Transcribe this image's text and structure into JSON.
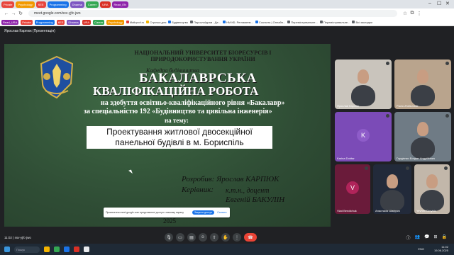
{
  "browser": {
    "tabs": [
      {
        "label": "Private",
        "color": "#e8453c"
      },
      {
        "label": "Psychology",
        "color": "#f29900"
      },
      {
        "label": "КЕЕ",
        "color": "#e8453c"
      },
      {
        "label": "Programming",
        "color": "#1a73e8"
      },
      {
        "label": "Dharma",
        "color": "#7e57c2"
      },
      {
        "label": "Career",
        "color": "#34a853"
      },
      {
        "label": "URA",
        "color": "#d93025"
      },
      {
        "label": "Read_EN",
        "color": "#8e24aa"
      }
    ],
    "url": "meet.google.com/ssv-yjfc-jwo",
    "bookmarks": [
      {
        "label": "Read_URA",
        "color": "#8e24aa",
        "kind": "colored"
      },
      {
        "label": "Private",
        "color": "#e8453c",
        "kind": "colored"
      },
      {
        "label": "Programming",
        "color": "#1a73e8",
        "kind": "colored"
      },
      {
        "label": "КЕЕ",
        "color": "#e8453c",
        "kind": "colored"
      },
      {
        "label": "Dharma",
        "color": "#7e57c2",
        "kind": "colored"
      },
      {
        "label": "URA",
        "color": "#d93025",
        "kind": "colored"
      },
      {
        "label": "Career",
        "color": "#34a853",
        "kind": "colored"
      },
      {
        "label": "Psychology",
        "color": "#f29900",
        "kind": "colored"
      },
      {
        "label": "Mathprof.ru",
        "color": "#e53935",
        "kind": "plain"
      },
      {
        "label": "Строчка для",
        "color": "#f4b400",
        "kind": "plain"
      },
      {
        "label": "Будівництво",
        "color": "#1a73e8",
        "kind": "plain"
      },
      {
        "label": "Пароклоїдизм - Де...",
        "color": "#5f6368",
        "kind": "plain"
      },
      {
        "label": "НМ КБ: Регламенв...",
        "color": "#1a73e8",
        "kind": "plain"
      },
      {
        "label": "Coursera | Онлайн...",
        "color": "#1a73e8",
        "kind": "plain"
      },
      {
        "label": "Перемістуєвальне...",
        "color": "#5f6368",
        "kind": "plain"
      },
      {
        "label": "Перемістуєвальне...",
        "color": "#5f6368",
        "kind": "plain"
      },
      {
        "label": "Всі закладки",
        "color": "#5f6368",
        "kind": "plain"
      }
    ]
  },
  "meet": {
    "presenter_label": "Ярослав Карпюк (Презентація)",
    "meeting_code": "ssv-yjfc-jwo",
    "time": "11:02",
    "notice": {
      "message": "Присвоєння meet.google.com представлені доступ з вашому екрану",
      "primary": "Закрити доступ",
      "secondary": "Сховати"
    }
  },
  "slide": {
    "university": "НАЦІОНАЛЬНИЙ УНІВЕРСИТЕТ БІОРЕСУРСІВ І ПРИРОДОКОРИСТУВАННЯ УКРАЇНИ",
    "department": "Кафедра будівництва",
    "title_line1": "БАКАЛАВРСЬКА",
    "title_line2": "КВАЛІФІКАЦІЙНА РОБОТА",
    "degree_line1": "на здобуття освітньо-кваліфікаційного рівня «Бакалавр»",
    "degree_line2": "за спеціальністю 192 «Будівництво та цивільна інженерія»",
    "on_topic": "на тему:",
    "topic_line1": "Проектування житлової двосекційної",
    "topic_line2": "панельної будівлі в м. Бориспіль",
    "author": "Розробив: Ярослав КАРПЮК",
    "supervisor_label": "Керівник:",
    "supervisor_degree": "к.т.н., доцент",
    "supervisor_name": "Евгеній БАКУЛІН",
    "year": "2025"
  },
  "participants": [
    {
      "name": "Ярослав Карпюк",
      "type": "video",
      "bg": "#c9c4bc"
    },
    {
      "name": "Pavlo Zhelezniak",
      "type": "video",
      "bg": "#b9a48d"
    },
    {
      "name": "Karina Dohtar",
      "type": "avatar",
      "letter": "K",
      "bg": "#7b4bb7",
      "avatar": "#8e5cc9"
    },
    {
      "name": "Гордієнко Богдан Андрійович",
      "type": "video",
      "bg": "#6f7b85"
    },
    {
      "name": "Vlad Bendichuk",
      "type": "avatar",
      "letter": "V",
      "bg": "#6a1b3a",
      "avatar": "#b0245a"
    },
    {
      "name": "Анастасія Шафрич",
      "type": "video",
      "bg": "#222a3a"
    },
    {
      "name": "Yevhen Dmytriv",
      "type": "video",
      "bg": "#c2b7aa"
    }
  ],
  "taskbar": {
    "search": "Пошук",
    "lang": "ENG",
    "clock_time": "11:02",
    "clock_date": "19.06.2025"
  }
}
